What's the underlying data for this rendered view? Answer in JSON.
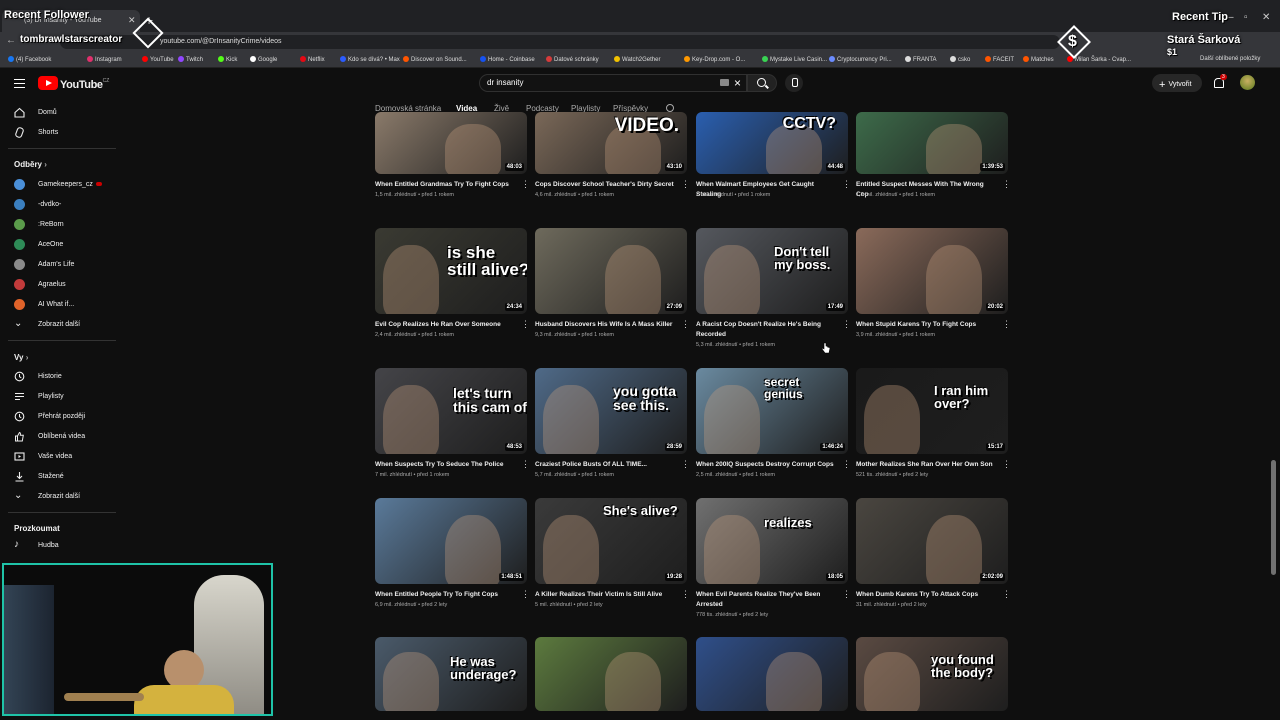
{
  "browser": {
    "tab_title": "(3) Dr Insanity - YouTube",
    "url": "youtube.com/@DrInsanityCrime/videos",
    "bookmarks": [
      {
        "label": "(4) Facebook",
        "color": "#1877f2"
      },
      {
        "label": "Instagram",
        "color": "#e1306c"
      },
      {
        "label": "YouTube",
        "color": "#ff0000"
      },
      {
        "label": "Twitch",
        "color": "#9146ff"
      },
      {
        "label": "Kick",
        "color": "#53fc18"
      },
      {
        "label": "Google",
        "color": "#ffffff"
      },
      {
        "label": "Netflix",
        "color": "#e50914"
      },
      {
        "label": "Kdo se dívá? • Max",
        "color": "#2b5cff"
      },
      {
        "label": "Discover on Sound...",
        "color": "#ff5500"
      },
      {
        "label": "Home - Coinbase",
        "color": "#1652f0"
      },
      {
        "label": "Datové schránky",
        "color": "#d63b3b"
      },
      {
        "label": "Watch2Gether",
        "color": "#f2c200"
      },
      {
        "label": "Key-Drop.com - O...",
        "color": "#ff9900"
      },
      {
        "label": "Mystake Live Casin...",
        "color": "#39d353"
      },
      {
        "label": "Cryptocurrency Pri...",
        "color": "#6b8cff"
      },
      {
        "label": "FRANTA",
        "color": "#dddddd"
      },
      {
        "label": "csko",
        "color": "#dddddd"
      },
      {
        "label": "FACEIT",
        "color": "#ff5500"
      },
      {
        "label": "Matches",
        "color": "#ff5500"
      },
      {
        "label": "Milan Šarka - Cvap...",
        "color": "#ff0000"
      }
    ],
    "other_bookmarks": "Další oblíbené položky"
  },
  "overlays": {
    "recent_follower_label": "Recent Follower",
    "recent_follower_name": "tombrawlstarscreator",
    "recent_tip_label": "Recent Tip",
    "recent_tip_name": "Stará Šarková",
    "recent_tip_amount": "$1"
  },
  "header": {
    "logo_text": "YouTube",
    "logo_region": "CZ",
    "search_value": "dr insanity",
    "create_label": "Vytvořit",
    "notification_count": "3"
  },
  "channel_tabs": {
    "tabs": [
      "Domovská stránka",
      "Videa",
      "Živě",
      "Podcasty",
      "Playlisty",
      "Příspěvky"
    ],
    "active": "Videa"
  },
  "sidebar": {
    "main": [
      {
        "label": "Domů",
        "icon": "home-icon"
      },
      {
        "label": "Shorts",
        "icon": "shorts-icon"
      }
    ],
    "subscriptions_heading": "Odběry",
    "subscriptions": [
      {
        "label": "Gamekeepers_cz",
        "color": "#4a8fd8"
      },
      {
        "label": "-dvdko-",
        "color": "#3b7fbf"
      },
      {
        "label": ":ReBorn",
        "color": "#5a9b4a"
      },
      {
        "label": "AceOne",
        "color": "#2e8b57"
      },
      {
        "label": "Adam's Life",
        "color": "#8a8a8a"
      },
      {
        "label": "Agraelus",
        "color": "#c23b3b"
      },
      {
        "label": "AI What if...",
        "color": "#e0632a"
      }
    ],
    "show_more": "Zobrazit další",
    "you_heading": "Vy",
    "you_items": [
      {
        "label": "Historie",
        "icon": "history-icon"
      },
      {
        "label": "Playlisty",
        "icon": "playlists-icon"
      },
      {
        "label": "Přehrát později",
        "icon": "watch-later-icon"
      },
      {
        "label": "Oblíbená videa",
        "icon": "liked-icon"
      },
      {
        "label": "Vaše videa",
        "icon": "your-videos-icon"
      },
      {
        "label": "Stažené",
        "icon": "download-icon"
      }
    ],
    "show_more_2": "Zobrazit další",
    "explore_heading": "Prozkoumat",
    "explore_items": [
      {
        "label": "Hudba",
        "icon": "music-icon"
      }
    ]
  },
  "videos": [
    {
      "title": "When Entitled Grandmas Try To Fight Cops",
      "meta": "1,5 mil. zhlédnutí • před 1 rokem",
      "duration": "48:03",
      "caption": "",
      "bg": "#8a7a6a"
    },
    {
      "title": "Cops Discover School Teacher's Dirty Secret",
      "meta": "4,6 mil. zhlédnutí • před 1 rokem",
      "duration": "43:10",
      "caption": "VIDEO.",
      "bg": "#7a6858"
    },
    {
      "title": "When Walmart Employees Get Caught Stealing",
      "meta": "2 mil. zhlédnutí • před 1 rokem",
      "duration": "44:48",
      "caption": "CCTV?",
      "bg": "#2a5fb0"
    },
    {
      "title": "Entitled Suspect Messes With The Wrong Cop",
      "meta": "1,2 mil. zhlédnutí • před 1 rokem",
      "duration": "1:39:53",
      "caption": "",
      "bg": "#3d6b4a"
    },
    {
      "title": "Evil Cop Realizes He Ran Over Someone",
      "meta": "2,4 mil. zhlédnutí • před 1 rokem",
      "duration": "24:34",
      "caption": "is she\nstill alive?",
      "bg": "#3a3a32"
    },
    {
      "title": "Husband Discovers His Wife Is A Mass Killer",
      "meta": "9,3 mil. zhlédnutí • před 1 rokem",
      "duration": "27:09",
      "caption": "",
      "bg": "#6e6a5c"
    },
    {
      "title": "A Racist Cop Doesn't Realize He's Being Recorded",
      "meta": "5,3 mil. zhlédnutí • před 1 rokem",
      "duration": "17:49",
      "caption": "Don't tell\nmy boss.",
      "bg": "#55585e"
    },
    {
      "title": "When Stupid Karens Try To Fight Cops",
      "meta": "3,9 mil. zhlédnutí • před 1 rokem",
      "duration": "20:02",
      "caption": "",
      "bg": "#8a6a5a"
    },
    {
      "title": "When Suspects Try To Seduce The Police",
      "meta": "7 mil. zhlédnutí • před 1 rokem",
      "duration": "48:53",
      "caption": "let's turn\nthis cam off.",
      "bg": "#444448"
    },
    {
      "title": "Craziest Police Busts Of ALL TIME...",
      "meta": "5,7 mil. zhlédnutí • před 1 rokem",
      "duration": "28:59",
      "caption": "you gotta\nsee this.",
      "bg": "#4f6a88"
    },
    {
      "title": "When 200IQ Suspects Destroy Corrupt Cops",
      "meta": "2,5 mil. zhlédnutí • před 1 rokem",
      "duration": "1:46:24",
      "caption": "secret\ngenius",
      "bg": "#6a8aa0"
    },
    {
      "title": "Mother Realizes She Ran Over Her Own Son",
      "meta": "521 tis. zhlédnutí • před 2 lety",
      "duration": "15:17",
      "caption": "I ran him\nover?",
      "bg": "#1a1a1a"
    },
    {
      "title": "When Entitled People Try To Fight Cops",
      "meta": "6,9 mil. zhlédnutí • před 2 lety",
      "duration": "1:48:51",
      "caption": "",
      "bg": "#5a7a9a"
    },
    {
      "title": "A Killer Realizes Their Victim Is Still Alive",
      "meta": "5 mil. zhlédnutí • před 2 lety",
      "duration": "19:28",
      "caption": "She's alive?",
      "bg": "#3a3a3a"
    },
    {
      "title": "When Evil Parents Realize They've Been Arrested",
      "meta": "778 tis. zhlédnutí • před 2 lety",
      "duration": "18:05",
      "caption": "realizes",
      "bg": "#707070"
    },
    {
      "title": "When Dumb Karens Try To Attack Cops",
      "meta": "31 mil. zhlédnutí • před 2 lety",
      "duration": "2:02:09",
      "caption": "",
      "bg": "#4a4640"
    },
    {
      "title": "",
      "meta": "",
      "duration": "",
      "caption": "He was\nunderage?",
      "bg": "#4a5a6a"
    },
    {
      "title": "",
      "meta": "",
      "duration": "",
      "caption": "",
      "bg": "#5c7a3e"
    },
    {
      "title": "",
      "meta": "",
      "duration": "",
      "caption": "",
      "bg": "#2f4f8a"
    },
    {
      "title": "",
      "meta": "",
      "duration": "",
      "caption": "you found\nthe body?",
      "bg": "#5a4a42"
    }
  ]
}
